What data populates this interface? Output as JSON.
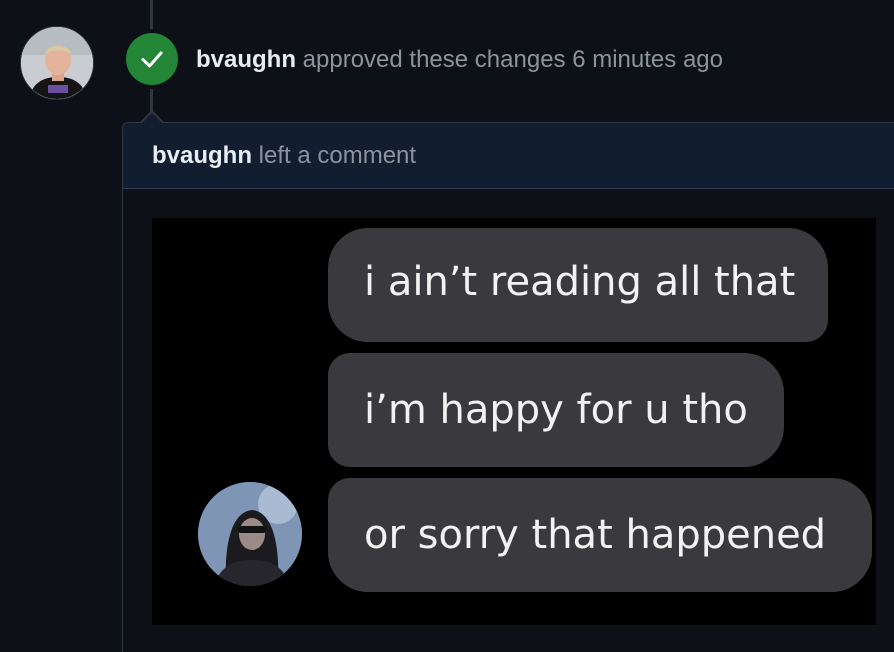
{
  "review_event": {
    "author": "bvaughn",
    "action": "approved these changes",
    "time": "6 minutes ago",
    "status_color": "#238636",
    "status_icon": "check-icon"
  },
  "comment": {
    "author": "bvaughn",
    "action": "left a comment"
  },
  "meme": {
    "messages": [
      "i ain’t reading all that",
      "i’m happy for u tho",
      "or sorry that happened"
    ]
  },
  "colors": {
    "background": "#0d1117",
    "header_background": "#121d2f",
    "bubble": "#3a3a3e"
  }
}
